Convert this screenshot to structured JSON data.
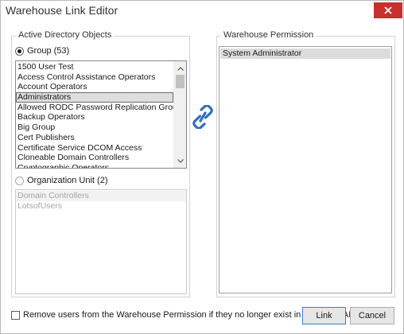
{
  "window": {
    "title": "Warehouse Link Editor"
  },
  "ad_objects": {
    "legend": "Active Directory Objects",
    "group_radio": "Group (53)",
    "group_items": [
      "1500 User Test",
      "Access Control Assistance Operators",
      "Account Operators",
      "Administrators",
      "Allowed RODC Password Replication Group",
      "Backup Operators",
      "Big Group",
      "Cert Publishers",
      "Certificate Service DCOM Access",
      "Cloneable Domain Controllers",
      "Cryptographic Operators"
    ],
    "selected_group": "Administrators",
    "ou_radio": "Organization Unit (2)",
    "ou_items": [
      "Domain Controllers",
      "LotsofUsers"
    ]
  },
  "warehouse_permission": {
    "legend": "Warehouse Permission",
    "items": [
      "System Administrator"
    ]
  },
  "footer": {
    "remove_users_checkbox": "Remove users from the Warehouse Permission if they no longer exist in the linked AD object",
    "link_button": "Link",
    "cancel_button": "Cancel"
  },
  "icons": {
    "link": "link-chain-icon",
    "close": "close-icon"
  },
  "colors": {
    "close_button": "#c7312d",
    "link_icon": "#2f6fbf"
  }
}
